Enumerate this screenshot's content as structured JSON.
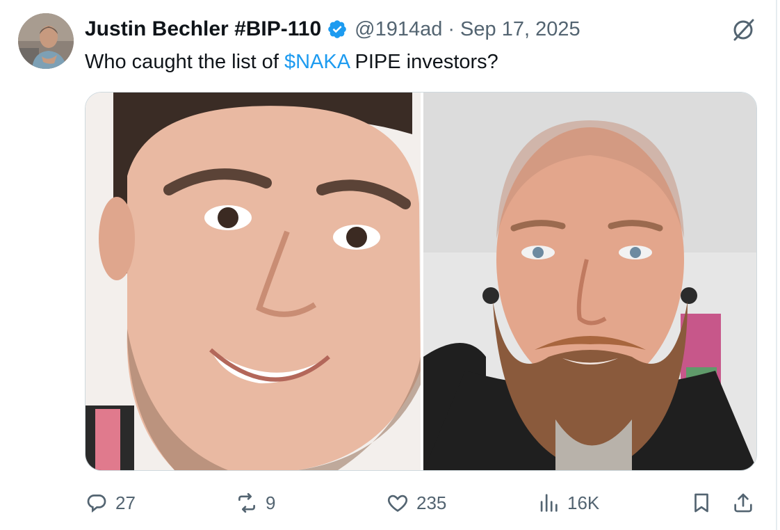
{
  "post": {
    "author_name": "Justin Bechler #BIP-110",
    "handle": "@1914ad",
    "separator": "·",
    "date": "Sep 17, 2025",
    "verified": true,
    "text_before": "Who caught the list of ",
    "cashtag": "$NAKA",
    "text_after": " PIPE investors?",
    "media": [
      {
        "description": "photo-left"
      },
      {
        "description": "photo-right"
      }
    ]
  },
  "actions": {
    "replies": "27",
    "reposts": "9",
    "likes": "235",
    "views": "16K"
  },
  "colors": {
    "text": "#0f1419",
    "muted": "#536471",
    "link": "#1d9bf0",
    "verified": "#1d9bf0"
  },
  "icons": {
    "reply": "reply-icon",
    "repost": "repost-icon",
    "like": "heart-icon",
    "views": "views-icon",
    "bookmark": "bookmark-icon",
    "share": "share-icon",
    "grok": "grok-icon",
    "verified": "verified-badge-icon"
  }
}
